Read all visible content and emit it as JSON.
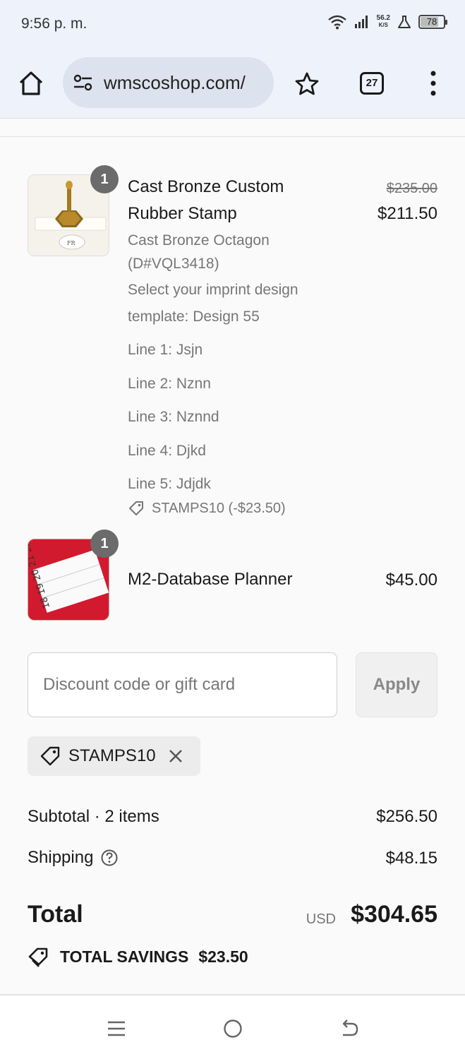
{
  "status_bar": {
    "time": "9:56 p. m.",
    "net_speed_value": "56.2",
    "net_speed_unit": "K/S",
    "battery": "78",
    "battery_level": 0.78
  },
  "browser": {
    "url": "wmscoshop.com/",
    "tab_count": "27"
  },
  "cart": {
    "items": [
      {
        "quantity": "1",
        "title_line1": "Cast Bronze Custom",
        "title_line2": "Rubber Stamp",
        "variant_line1": "Cast Bronze Octagon",
        "variant_line2": "(D#VQL3418)",
        "design_line1": "Select your imprint design",
        "design_line2": "template: Design 55",
        "lines": [
          "Line 1: Jsjn",
          "Line 2: Nznn",
          "Line 3: Nznnd",
          "Line 4: Djkd",
          "Line 5: Jdjdk"
        ],
        "discount": "STAMPS10 (-$23.50)",
        "original_price": "$235.00",
        "price": "$211.50"
      },
      {
        "quantity": "1",
        "title": "M2-Database Planner",
        "price": "$45.00",
        "image_text": "18 19 20 21 22 23"
      }
    ]
  },
  "discount": {
    "placeholder": "Discount code or gift card",
    "apply_label": "Apply",
    "applied_code": "STAMPS10"
  },
  "summary": {
    "subtotal_label": "Subtotal · 2 items",
    "subtotal_value": "$256.50",
    "shipping_label": "Shipping",
    "shipping_value": "$48.15",
    "total_label": "Total",
    "currency": "USD",
    "total_value": "$304.65",
    "savings_label": "TOTAL SAVINGS",
    "savings_value": "$23.50"
  },
  "colors": {
    "chrome_bg": "#eef2fb",
    "badge": "#6b6b6b",
    "planner_red": "#c8102e"
  }
}
